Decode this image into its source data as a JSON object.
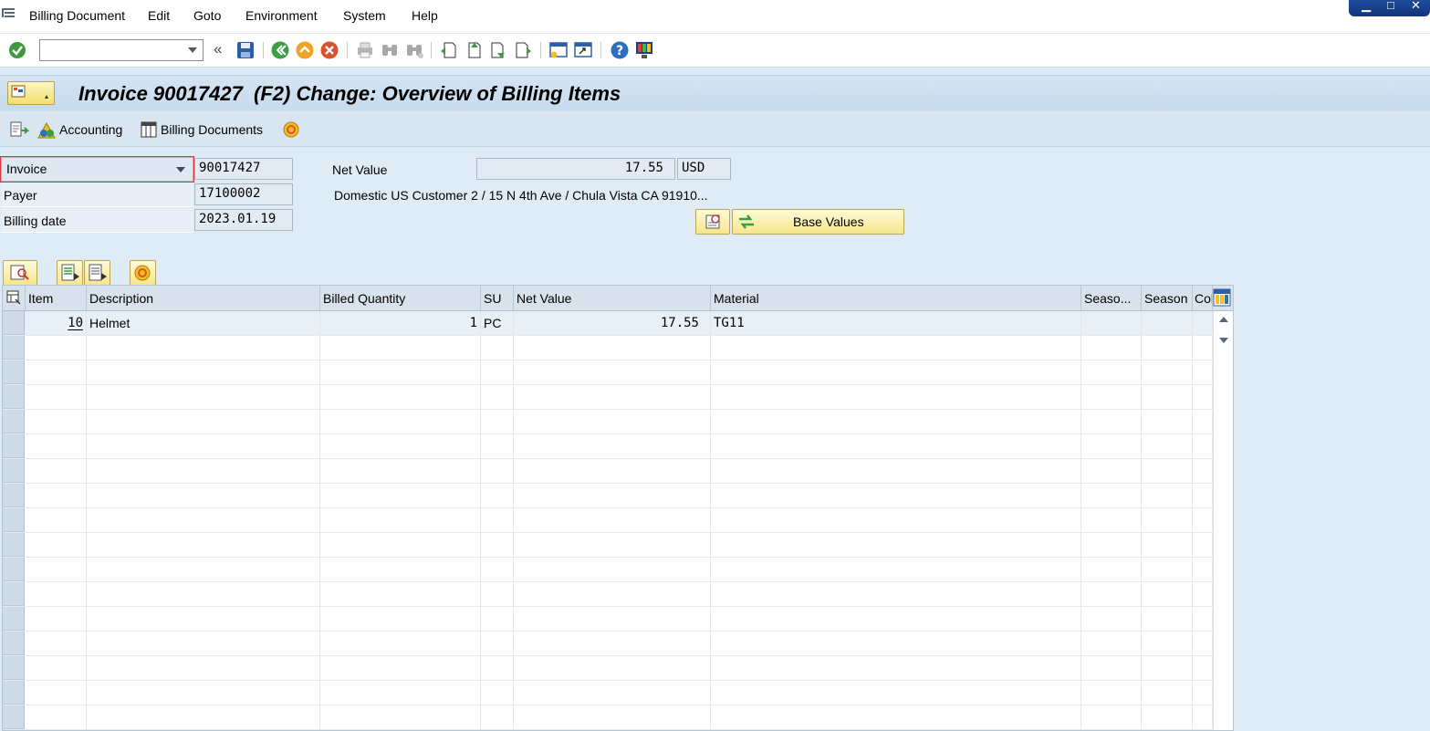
{
  "menu": {
    "items": [
      "Billing Document",
      "Edit",
      "Goto",
      "Environment",
      "System",
      "Help"
    ]
  },
  "toolbar": {
    "command_field_value": "",
    "icons": [
      "enter-check-icon",
      "back-double-chevron-icon",
      "save-icon",
      "back-icon",
      "exit-icon",
      "cancel-icon",
      "print-icon",
      "find-icon",
      "find-next-icon",
      "first-page-icon",
      "previous-page-icon",
      "next-page-icon",
      "last-page-icon",
      "create-session-icon",
      "create-shortcut-icon",
      "help-icon",
      "customize-layout-icon"
    ]
  },
  "title": {
    "text": "Invoice 90017427  (F2) Change: Overview of Billing Items"
  },
  "app_toolbar": {
    "accounting_label": "Accounting",
    "billing_documents_label": "Billing Documents"
  },
  "header": {
    "doc_type_value": "Invoice",
    "doc_number": "90017427",
    "payer_label": "Payer",
    "payer_value": "17100002",
    "billing_date_label": "Billing date",
    "billing_date_value": "2023.01.19",
    "net_value_label": "Net Value",
    "net_value": "17.55",
    "currency": "USD",
    "customer_address": "Domestic US Customer 2 / 15 N 4th Ave / Chula Vista CA 91910...",
    "base_values_label": "Base Values"
  },
  "table": {
    "columns": [
      "Item",
      "Description",
      "Billed Quantity",
      "SU",
      "Net Value",
      "Material",
      "Seaso...",
      "Season",
      "Col"
    ],
    "rows": [
      {
        "item": "10",
        "description": "Helmet",
        "billed_quantity": "1",
        "su": "PC",
        "net_value": "17.55",
        "material": "TG11",
        "season_cat": "",
        "season": "",
        "col": ""
      }
    ]
  },
  "colors": {
    "background": "#dfebf5",
    "title_bar": "#c7dbed",
    "button_yellow": "#f7e58b",
    "table_header": "#d7e2ec"
  }
}
